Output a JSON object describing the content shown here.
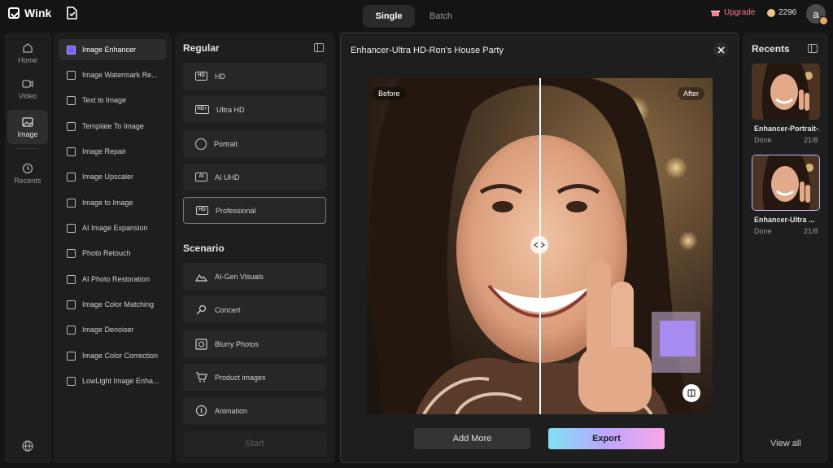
{
  "app": {
    "name": "Wink"
  },
  "top": {
    "tabs": [
      {
        "label": "Single",
        "active": true
      },
      {
        "label": "Batch",
        "active": false
      }
    ],
    "upgrade_label": "Upgrade",
    "credits": "2296",
    "avatar_letter": "a"
  },
  "rail": {
    "items": [
      {
        "label": "Home",
        "icon": "home-icon"
      },
      {
        "label": "Video",
        "icon": "video-icon"
      },
      {
        "label": "Image",
        "icon": "image-icon",
        "active": true
      },
      {
        "label": "Recents",
        "icon": "clock-icon"
      }
    ]
  },
  "tools": {
    "items": [
      {
        "label": "Image Enhancer",
        "active": true
      },
      {
        "label": "Image Watermark Re..."
      },
      {
        "label": "Text to Image"
      },
      {
        "label": "Template To Image"
      },
      {
        "label": "Image Repair"
      },
      {
        "label": "Image Upscaler"
      },
      {
        "label": "Image to Image"
      },
      {
        "label": "AI Image Expansion"
      },
      {
        "label": "Photo Retouch"
      },
      {
        "label": "AI Photo Restoration"
      },
      {
        "label": "Image Color Matching"
      },
      {
        "label": "Image Denoiser"
      },
      {
        "label": "Image Color Correction"
      },
      {
        "label": "LowLight Image Enha..."
      }
    ]
  },
  "options": {
    "regular_title": "Regular",
    "regular": [
      {
        "label": "HD",
        "icon": "hd-icon",
        "glyph": "HD"
      },
      {
        "label": "Ultra HD",
        "icon": "hd-plus-icon",
        "glyph": "HD+"
      },
      {
        "label": "Portrait",
        "icon": "face-icon",
        "glyph": ""
      },
      {
        "label": "AI UHD",
        "icon": "ai-uhd-icon",
        "glyph": "AI"
      },
      {
        "label": "Professional",
        "icon": "hd-pro-icon",
        "glyph": "HD",
        "active": true
      }
    ],
    "scenario_title": "Scenario",
    "scenario": [
      {
        "label": "AI-Gen Visuals",
        "icon": "ai-visuals-icon"
      },
      {
        "label": "Concert",
        "icon": "microphone-icon"
      },
      {
        "label": "Blurry Photos",
        "icon": "blur-icon"
      },
      {
        "label": "Product images",
        "icon": "cart-icon"
      },
      {
        "label": "Animation",
        "icon": "animation-icon"
      }
    ],
    "start_label": "Start"
  },
  "viewer": {
    "title": "Enhancer-Ultra HD-Ron's House Party",
    "before_label": "Before",
    "after_label": "After",
    "split_position": 0.5,
    "add_more_label": "Add More",
    "export_label": "Export"
  },
  "recents": {
    "title": "Recents",
    "items": [
      {
        "name": "Enhancer-Portrait-...",
        "status": "Done",
        "count": "21/8"
      },
      {
        "name": "Enhancer-Ultra ...",
        "status": "Done",
        "count": "21/8",
        "selected": true
      }
    ],
    "view_all_label": "View all"
  },
  "colors": {
    "accent": "#7a5cff",
    "upgrade": "#ff7a91",
    "export_gradient": [
      "#7fe0f2",
      "#bda6ff",
      "#f9a7e8"
    ]
  }
}
